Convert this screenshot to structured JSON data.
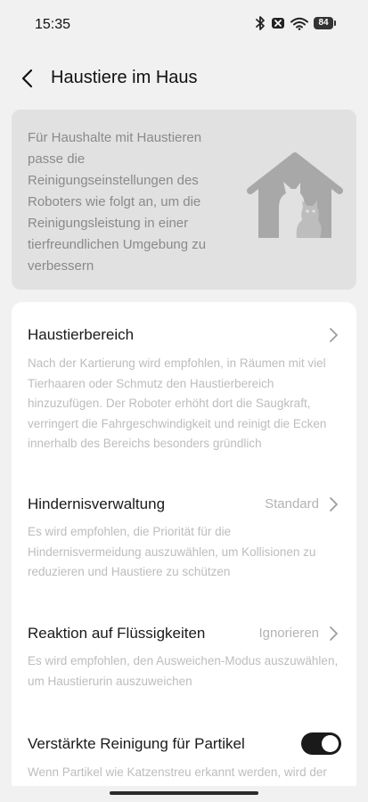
{
  "status_bar": {
    "time": "15:35",
    "battery": "84",
    "icons": [
      "bluetooth-icon",
      "no-sim-icon",
      "wifi-icon",
      "battery-icon"
    ]
  },
  "header": {
    "title": "Haustiere im Haus"
  },
  "info_banner": {
    "text": "Für Haushalte mit Haustieren passe die Reinigungseinstellungen des Roboters wie folgt an, um die Reinigungsleistung in einer tierfreundlichen Umgebung zu verbessern",
    "illustration": "pet-house-icon"
  },
  "settings": [
    {
      "title": "Haustierbereich",
      "value": "",
      "description": "Nach der Kartierung wird empfohlen, in Räumen mit viel Tierhaaren oder Schmutz den Haustierbereich hinzuzufügen. Der Roboter erhöht dort die Saugkraft, verringert die Fahrgeschwindigkeit und reinigt die Ecken innerhalb des Bereichs besonders gründlich"
    },
    {
      "title": "Hindernisverwaltung",
      "value": "Standard",
      "description": "Es wird empfohlen, die Priorität für die Hindernisvermeidung auszuwählen, um Kollisionen zu reduzieren und Haustiere zu schützen"
    },
    {
      "title": "Reaktion auf Flüssigkeiten",
      "value": "Ignorieren",
      "description": "Es wird empfohlen, den Ausweichen-Modus auszuwählen, um Haustierurin auszuweichen"
    },
    {
      "title": "Verstärkte Reinigung für Partikel",
      "toggle_on": true,
      "description": "Wenn Partikel wie Katzenstreu erkannt werden, wird der"
    }
  ],
  "colors": {
    "background": "#f1f1f1",
    "banner": "#e1e1e1",
    "card": "#ffffff",
    "toggle_on": "#1a1a1a"
  }
}
